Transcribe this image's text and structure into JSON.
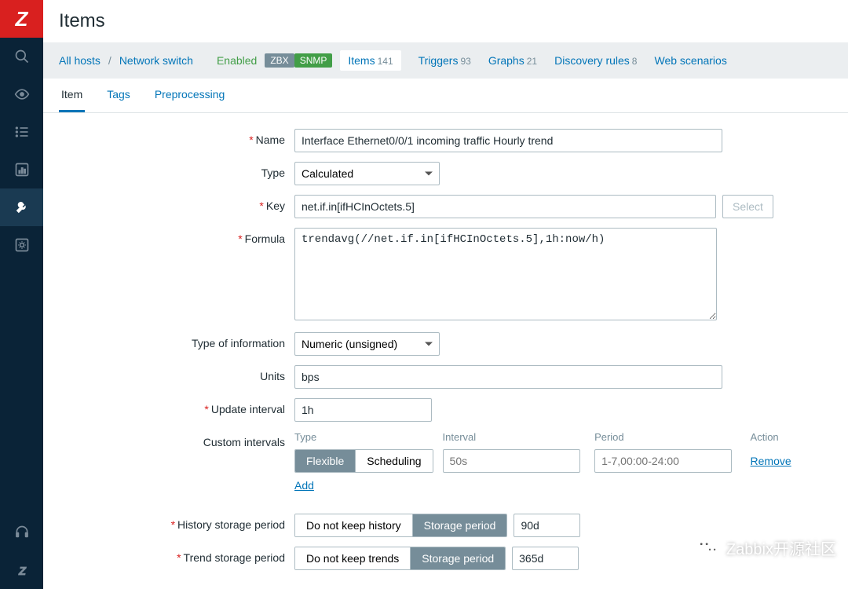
{
  "logo": "Z",
  "page_title": "Items",
  "breadcrumb": {
    "all_hosts": "All hosts",
    "host": "Network switch",
    "status": "Enabled",
    "tag_zbx": "ZBX",
    "tag_snmp": "SNMP"
  },
  "nav_counts": {
    "items_label": "Items",
    "items_n": "141",
    "triggers_label": "Triggers",
    "triggers_n": "93",
    "graphs_label": "Graphs",
    "graphs_n": "21",
    "discovery_label": "Discovery rules",
    "discovery_n": "8",
    "web_label": "Web scenarios"
  },
  "tabs": {
    "item": "Item",
    "tags": "Tags",
    "preproc": "Preprocessing"
  },
  "labels": {
    "name": "Name",
    "type": "Type",
    "key": "Key",
    "formula": "Formula",
    "type_info": "Type of information",
    "units": "Units",
    "update": "Update interval",
    "custom": "Custom intervals",
    "history": "History storage period",
    "trend": "Trend storage period"
  },
  "values": {
    "name": "Interface Ethernet0/0/1 incoming traffic Hourly trend",
    "type": "Calculated",
    "key": "net.if.in[ifHCInOctets.5]",
    "select_btn": "Select",
    "formula": "trendavg(//net.if.in[ifHCInOctets.5],1h:now/h)",
    "type_info": "Numeric (unsigned)",
    "units": "bps",
    "update": "1h"
  },
  "custom_intervals": {
    "head_type": "Type",
    "head_interval": "Interval",
    "head_period": "Period",
    "head_action": "Action",
    "seg_flexible": "Flexible",
    "seg_scheduling": "Scheduling",
    "ph_interval": "50s",
    "ph_period": "1-7,00:00-24:00",
    "remove": "Remove",
    "add": "Add"
  },
  "storage": {
    "history_no": "Do not keep history",
    "history_yes": "Storage period",
    "history_val": "90d",
    "trend_no": "Do not keep trends",
    "trend_yes": "Storage period",
    "trend_val": "365d"
  },
  "watermark": "Zabbix开源社区"
}
